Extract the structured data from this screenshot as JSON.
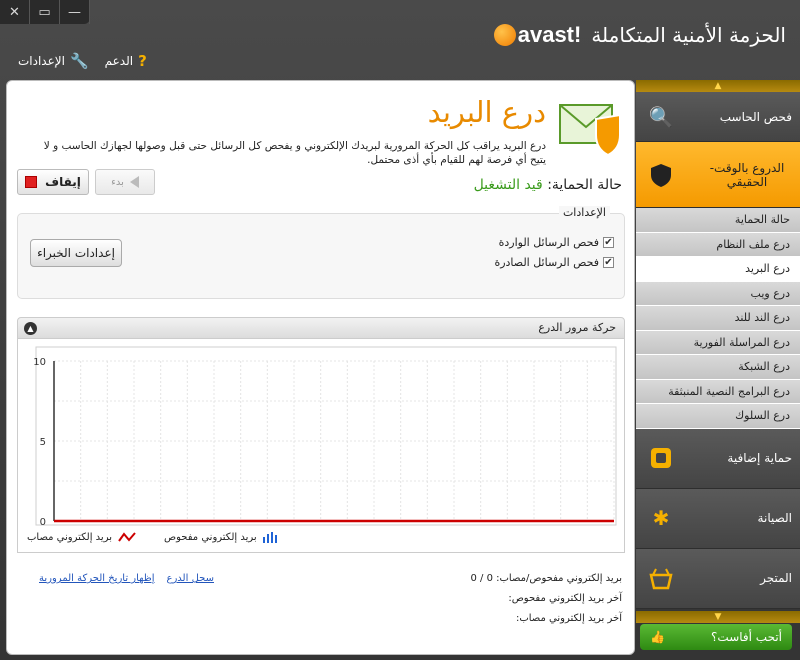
{
  "window": {
    "controls": [
      "✕",
      "▭",
      "—"
    ]
  },
  "brand": {
    "title": "الحزمة الأمنية المتكاملة",
    "logo_text": "avast!"
  },
  "toplinks": {
    "support": "الدعم",
    "settings": "الإعدادات"
  },
  "page": {
    "title": "درع البريد",
    "description": "درع البريد يراقب كل الحركة المرورية لبريدك الإلكتروني و يفحص كل الرسائل حتى قبل وصولها لجهازك الحاسب و لا يتيح أي فرصة لهم للقيام بأي أذى محتمل.",
    "status_label": "حالة الحماية:",
    "status_value": "قيد التشغيل",
    "start_button": "بدء",
    "stop_button": "إيقاف"
  },
  "settings": {
    "legend": "الإعدادات",
    "incoming": "فحص الرسائل الواردة",
    "outgoing": "فحص الرسائل الصادرة",
    "expert_button": "إعدادات الخبراء"
  },
  "traffic": {
    "title": "حركة مرور الدرع"
  },
  "chart_data": {
    "type": "line",
    "title": "حركة مرور الدرع",
    "ylim": [
      0,
      10
    ],
    "yticks": [
      "10",
      "5",
      "0"
    ],
    "series": [
      {
        "name": "بريد إلكتروني مفحوص",
        "values": [
          0,
          0,
          0,
          0,
          0,
          0,
          0,
          0,
          0,
          0,
          0,
          0,
          0,
          0,
          0,
          0,
          0,
          0,
          0,
          0,
          0,
          0
        ],
        "color": "#1f63d6"
      },
      {
        "name": "بريد إلكتروني مصاب",
        "values": [
          0,
          0,
          0,
          0,
          0,
          0,
          0,
          0,
          0,
          0,
          0,
          0,
          0,
          0,
          0,
          0,
          0,
          0,
          0,
          0,
          0,
          0
        ],
        "color": "#cc0000"
      }
    ],
    "grid": true
  },
  "legend": {
    "infected": "بريد إلكتروني مصاب",
    "scanned": "بريد إلكتروني مفحوص"
  },
  "stats": {
    "scanned_infected_label": "بريد إلكتروني مفحوص/مصاب:",
    "scanned_infected_value": "0 / 0",
    "last_scanned": "آخر بريد إلكتروني مفحوص:",
    "last_infected": "آخر بريد إلكتروني مصاب:"
  },
  "links": {
    "shield_log": "سجل الدرع",
    "traffic_history": "إظهار تاريخ الحركة المرورية"
  },
  "sidebar": {
    "scan": "فحص الحاسب",
    "realtime": "الدروع بالوقت-الحقيقي",
    "subitems": [
      "حالة الحماية",
      "درع ملف النظام",
      "درع البريد",
      "درع ويب",
      "درع الند للند",
      "درع المراسلة الفورية",
      "درع الشبكة",
      "درع البرامج النصية المنبثقة",
      "درع السلوك"
    ],
    "additional": "حماية إضافية",
    "maintenance": "الصيانة",
    "store": "المتجر",
    "love": "أتحب أفاست؟"
  }
}
